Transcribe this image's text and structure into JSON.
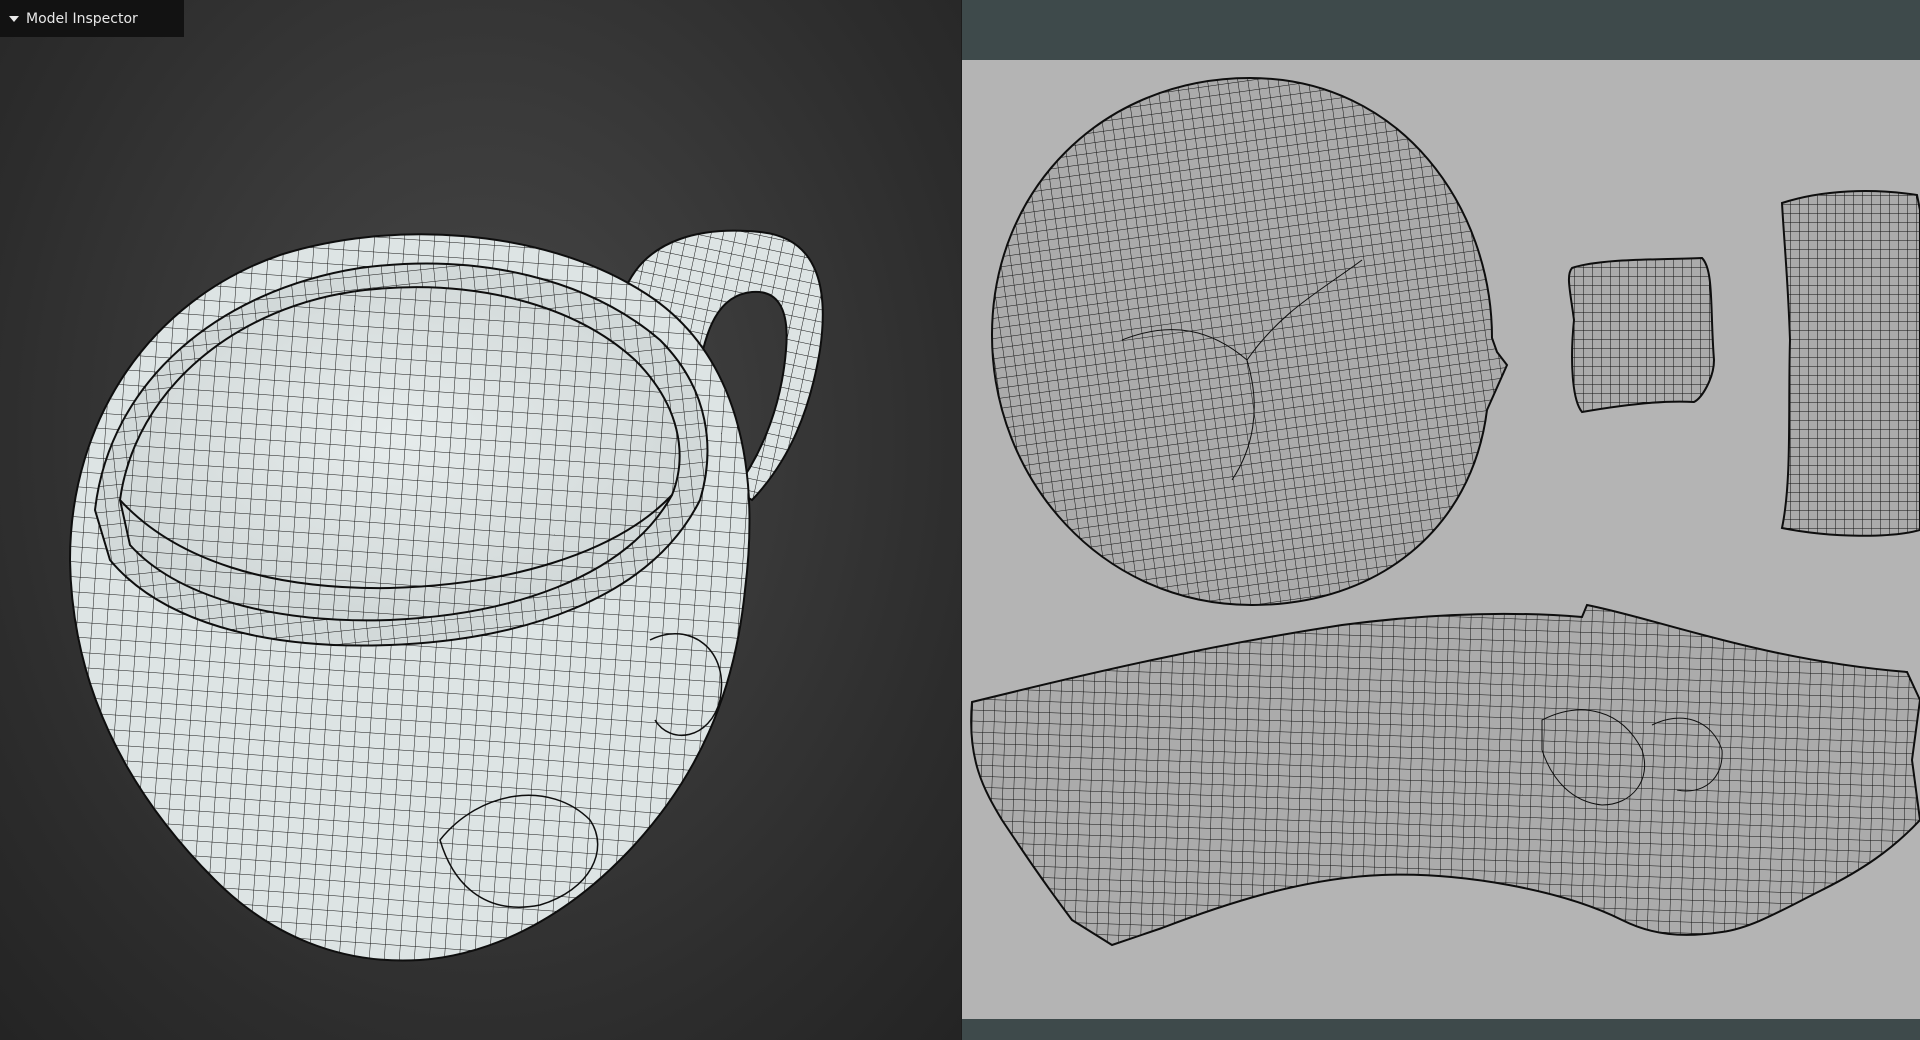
{
  "inspector": {
    "title": "Model Inspector",
    "collapse_icon": "caret-down-icon"
  },
  "viewport": {
    "background": "#2b2b2b",
    "model_fill": "#dde4e4",
    "wire_color": "#111111"
  },
  "uv_editor": {
    "frame_color": "#3e4a4b",
    "canvas_color": "#b4b4b4",
    "island_fill": "#a9a9a9",
    "wire_color": "#111111"
  }
}
